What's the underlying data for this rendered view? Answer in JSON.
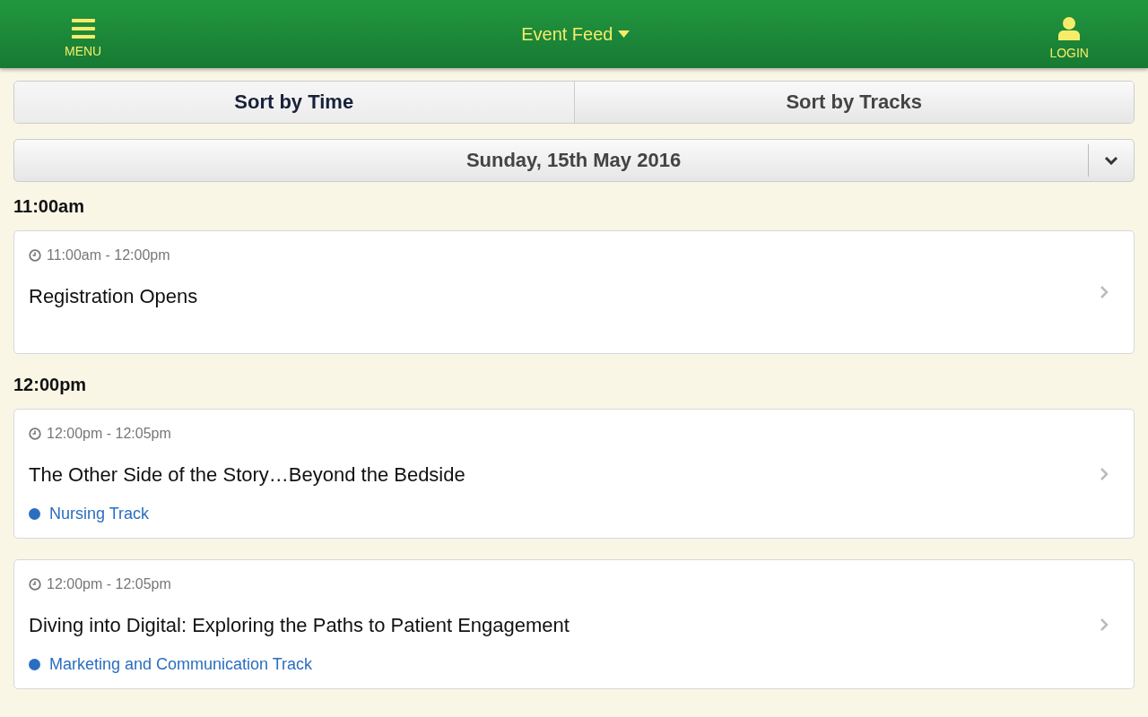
{
  "header": {
    "menu_label": "MENU",
    "title": "Event Feed",
    "login_label": "LOGIN"
  },
  "sort_tabs": [
    {
      "label": "Sort by Time",
      "selected": true
    },
    {
      "label": "Sort by Tracks",
      "selected": false
    }
  ],
  "date_selector": {
    "value": "Sunday, 15th May 2016"
  },
  "groups": [
    {
      "time": "11:00am",
      "sessions": [
        {
          "time_range": "11:00am - 12:00pm",
          "title": "Registration Opens"
        }
      ]
    },
    {
      "time": "12:00pm",
      "sessions": [
        {
          "time_range": "12:00pm - 12:05pm",
          "title": "The Other Side of the Story…Beyond the Bedside",
          "track": {
            "name": "Nursing Track",
            "color": "#2a6ebf"
          }
        },
        {
          "time_range": "12:00pm - 12:05pm",
          "title": "Diving into Digital: Exploring the Paths to Patient Engagement",
          "track": {
            "name": "Marketing and Communication Track",
            "color": "#2a6ebf"
          }
        }
      ]
    }
  ]
}
